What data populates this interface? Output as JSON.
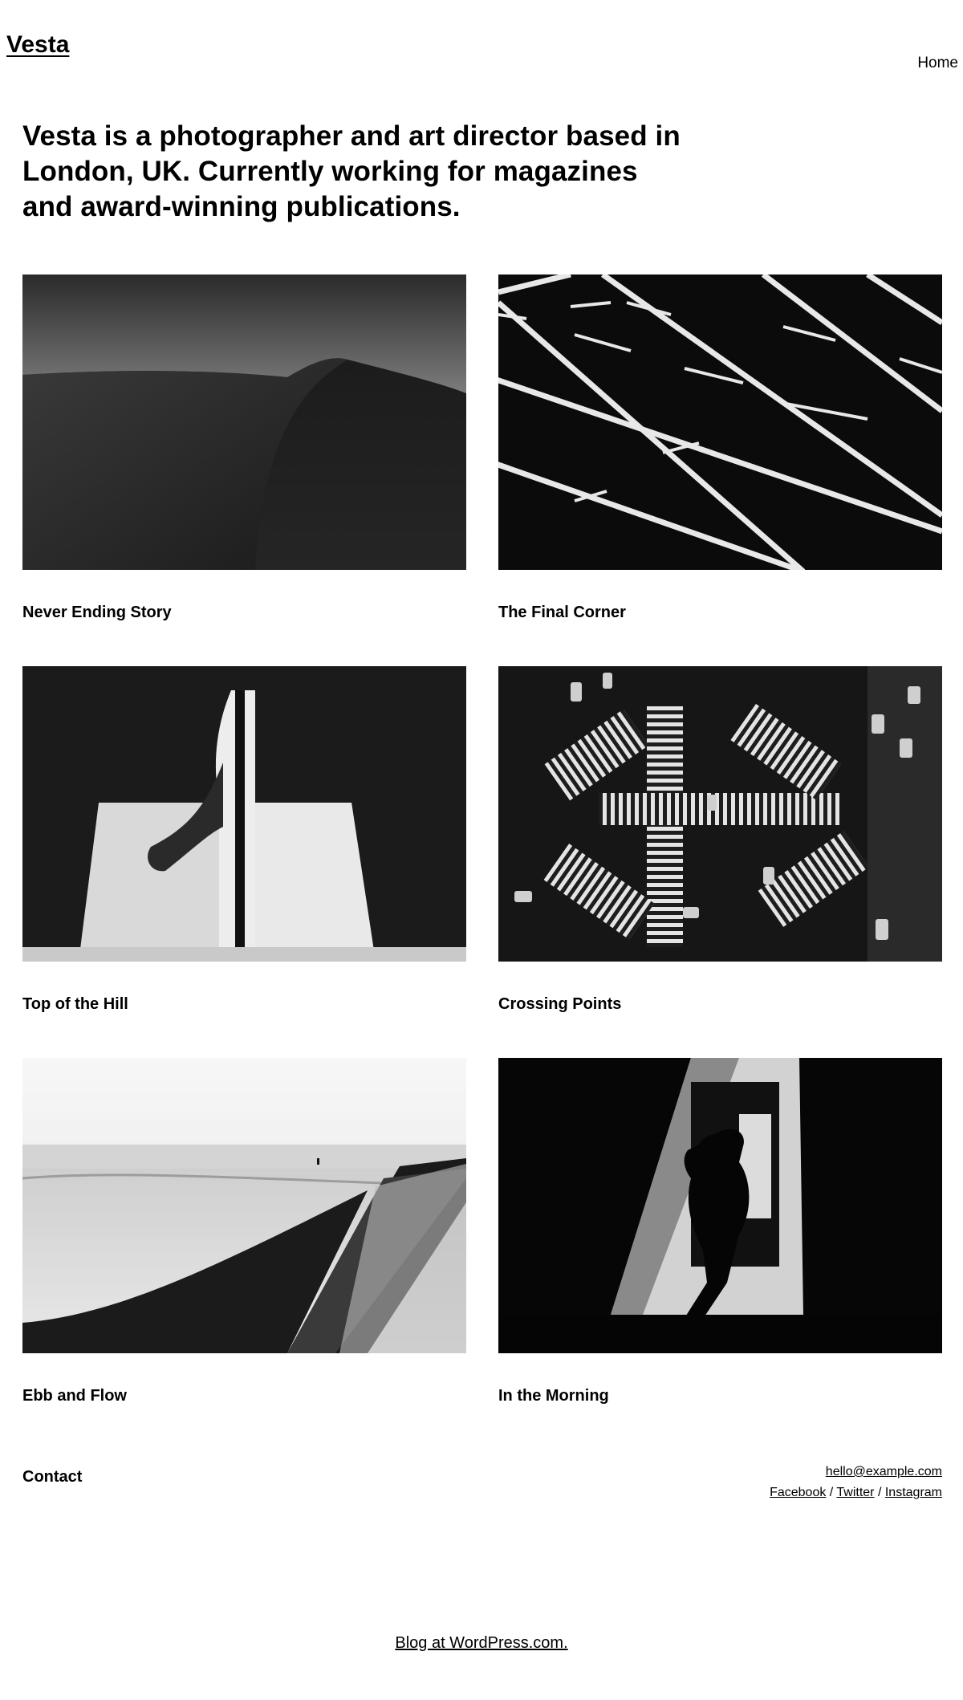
{
  "header": {
    "site_title": "Vesta",
    "nav": [
      {
        "label": "Home"
      }
    ]
  },
  "intro": {
    "text": "Vesta is a photographer and art director based in London, UK. Currently working for magazines and award-winning publications."
  },
  "projects": [
    {
      "title": "Never Ending Story",
      "image": "desert-dune-photo"
    },
    {
      "title": "The Final Corner",
      "image": "parking-lines-photo"
    },
    {
      "title": "Top of the Hill",
      "image": "white-building-photo"
    },
    {
      "title": "Crossing Points",
      "image": "street-crossing-aerial-photo"
    },
    {
      "title": "Ebb and Flow",
      "image": "beach-tide-photo"
    },
    {
      "title": "In the Morning",
      "image": "silhouette-walker-photo"
    }
  ],
  "contact": {
    "heading": "Contact",
    "email": "hello@example.com",
    "socials": [
      {
        "label": "Facebook"
      },
      {
        "label": "Twitter"
      },
      {
        "label": "Instagram"
      }
    ],
    "separator": " / "
  },
  "footer": {
    "credit": "Blog at WordPress.com."
  }
}
